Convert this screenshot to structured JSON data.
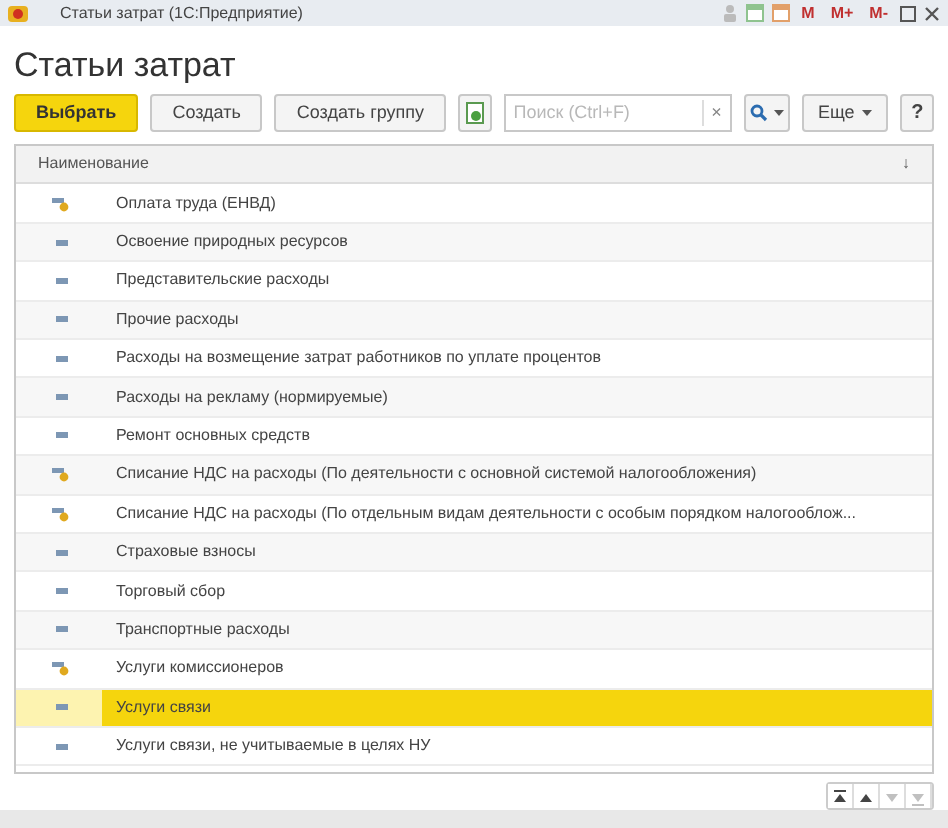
{
  "window": {
    "title": "Статьи затрат  (1С:Предприятие)",
    "memory_buttons": [
      "M",
      "M+",
      "M-"
    ]
  },
  "heading": "Статьи затрат",
  "toolbar": {
    "buttons": [
      {
        "label": "Выбрать",
        "kind": "primary"
      },
      {
        "label": "Создать",
        "kind": "normal"
      },
      {
        "label": "Создать группу",
        "kind": "normal"
      }
    ],
    "search": {
      "placeholder": "Поиск (Ctrl+F)",
      "clear": "×"
    },
    "more": "Еще",
    "help": "?"
  },
  "table": {
    "columns": [
      {
        "label": "Наименование",
        "sort": "↓"
      }
    ],
    "rows": [
      {
        "name": "Оплата труда (ЕНВД)",
        "kind": "marked",
        "selected": false
      },
      {
        "name": "Освоение природных ресурсов",
        "kind": "plain",
        "selected": false
      },
      {
        "name": "Представительские расходы",
        "kind": "plain",
        "selected": false
      },
      {
        "name": "Прочие расходы",
        "kind": "plain",
        "selected": false
      },
      {
        "name": "Расходы на возмещение затрат работников по уплате процентов",
        "kind": "plain",
        "selected": false
      },
      {
        "name": "Расходы на рекламу (нормируемые)",
        "kind": "plain",
        "selected": false
      },
      {
        "name": "Ремонт основных средств",
        "kind": "plain",
        "selected": false
      },
      {
        "name": "Списание НДС на расходы (По деятельности с основной системой налогообложения)",
        "kind": "marked",
        "selected": false
      },
      {
        "name": "Списание НДС на расходы (По отдельным видам деятельности с особым порядком налогооблож...",
        "kind": "marked",
        "selected": false
      },
      {
        "name": "Страховые взносы",
        "kind": "plain",
        "selected": false
      },
      {
        "name": "Торговый сбор",
        "kind": "plain",
        "selected": false
      },
      {
        "name": "Транспортные расходы",
        "kind": "plain",
        "selected": false
      },
      {
        "name": "Услуги комиссионеров",
        "kind": "marked",
        "selected": false
      },
      {
        "name": "Услуги связи",
        "kind": "plain",
        "selected": true
      },
      {
        "name": "Услуги связи, не учитываемые в целях НУ",
        "kind": "plain",
        "selected": false
      }
    ]
  },
  "navigation": [
    {
      "kind": "first",
      "disabled": false
    },
    {
      "kind": "up",
      "disabled": false
    },
    {
      "kind": "down",
      "disabled": true
    },
    {
      "kind": "last",
      "disabled": true
    }
  ]
}
